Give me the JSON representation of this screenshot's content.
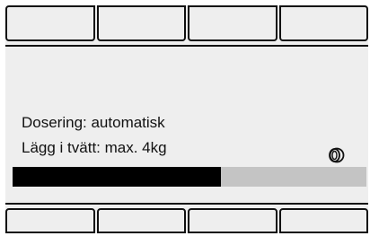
{
  "top_softkeys": [
    {
      "label": ""
    },
    {
      "label": ""
    },
    {
      "label": ""
    },
    {
      "label": ""
    }
  ],
  "status": {
    "dosing": "Dosering: automatisk",
    "load": "Lägg i tvätt: max. 4kg",
    "load_icon": "drum-icon"
  },
  "progress": {
    "fraction": 0.59
  },
  "bottom_softkeys": [
    {
      "label": ""
    },
    {
      "label": ""
    },
    {
      "label": ""
    },
    {
      "label": ""
    }
  ],
  "colors": {
    "background": "#eeeeee",
    "progress_fill": "#000000",
    "progress_track": "#c4c4c4"
  }
}
